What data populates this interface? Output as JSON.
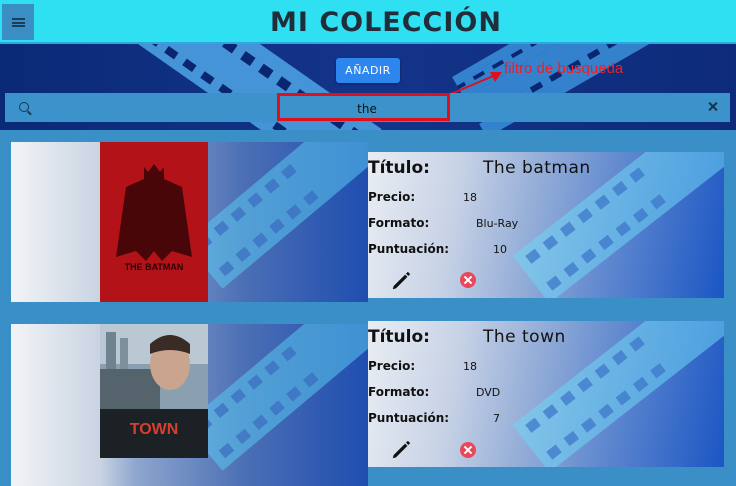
{
  "app": {
    "title": "MI COLECCIÓN"
  },
  "toolbar": {
    "add_label": "AÑADIR"
  },
  "search": {
    "value": "the",
    "annotation": "filtro de busqueda"
  },
  "labels": {
    "title": "Título:",
    "price": "Precio:",
    "format": "Formato:",
    "score": "Puntuación:"
  },
  "movies": [
    {
      "title": "The batman",
      "price": "18",
      "format": "Blu-Ray",
      "score": "10",
      "poster_text": "THE BATMAN"
    },
    {
      "title": "The town",
      "price": "18",
      "format": "DVD",
      "score": "7",
      "poster_text": "TOWN"
    }
  ],
  "colors": {
    "header": "#2ee0f2",
    "add_button": "#2c86ee",
    "annotation": "#e0101a",
    "delete": "#e8485a"
  }
}
